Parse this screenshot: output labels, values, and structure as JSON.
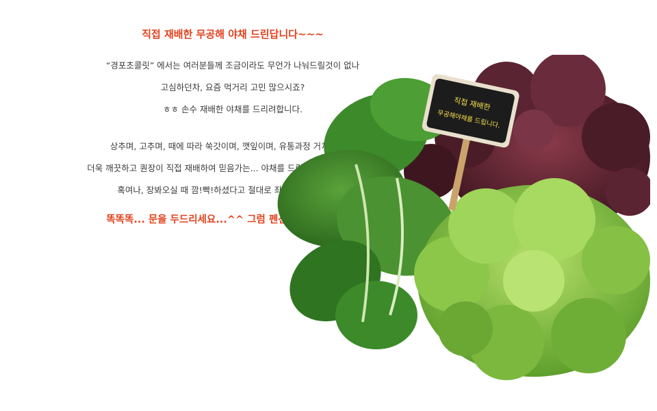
{
  "heading": "직접 재배한 무공해 야채 드린답니다~~~",
  "paragraph1": [
    "“경포초콜릿” 에서는 여러분들께 조금이라도 무언가 나눠드릴것이 없나",
    "고심하던차, 요즘 먹거리 고민 많으시죠?",
    "ㅎㅎ 손수 재배한 야채를 드리려합니다."
  ],
  "paragraph2": [
    "상추며, 고추며, 때에 따라 쑥갓이며, 깻잎이며, 유통과정 거치지 않아",
    "더욱 깨끗하고 퀀장이 직접 재배하여 믿음가는... 야채를 드립니다.(여름에만 제공)",
    "혹여나, 장봐오실 때 깜!빡!하셨다고 절대로 좌절하지 마시구요..."
  ],
  "closing": "똑똑똑... 문을 두드리세요...^^ 그럼 펜션에서 뵙겠습니다!",
  "sign": {
    "line1": "직접 재배한",
    "line2": "무공해야채를 드립니다."
  },
  "colors": {
    "accent": "#e2411c",
    "text": "#3b3b3b",
    "sign_text": "#f4e04d",
    "sign_board": "#1c1c1c"
  }
}
